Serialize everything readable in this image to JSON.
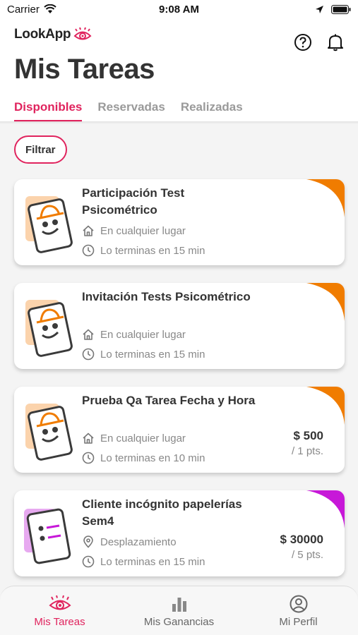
{
  "status_bar": {
    "carrier": "Carrier",
    "time": "9:08 AM"
  },
  "header": {
    "logo_text": "LookApp",
    "title": "Mis Tareas",
    "tabs": [
      {
        "label": "Disponibles",
        "active": true
      },
      {
        "label": "Reservadas",
        "active": false
      },
      {
        "label": "Realizadas",
        "active": false
      }
    ]
  },
  "filter_label": "Filtrar",
  "tasks": [
    {
      "title": "Participación Test Psicométrico",
      "location_icon": "home-icon",
      "location": "En cualquier lugar",
      "duration": "Lo terminas en 15 min",
      "price": "",
      "points": "",
      "icon": "incognito-card-icon",
      "accent": "#f07c00"
    },
    {
      "title": "Invitación Tests Psicométrico",
      "location_icon": "home-icon",
      "location": "En cualquier lugar",
      "duration": "Lo terminas en 15 min",
      "price": "",
      "points": "",
      "icon": "incognito-card-icon",
      "accent": "#f07c00"
    },
    {
      "title": "Prueba Qa Tarea Fecha y Hora",
      "location_icon": "home-icon",
      "location": "En cualquier lugar",
      "duration": "Lo terminas en 10 min",
      "price": "$ 500",
      "points": "/ 1 pts.",
      "icon": "incognito-card-icon",
      "accent": "#f07c00"
    },
    {
      "title": "Cliente incógnito papelerías Sem4",
      "location_icon": "location-pin-icon",
      "location": "Desplazamiento",
      "duration": "Lo terminas en 15 min",
      "price": "$ 30000",
      "points": "/ 5 pts.",
      "icon": "list-card-icon",
      "accent": "#c718d8"
    }
  ],
  "bottom_nav": [
    {
      "label": "Mis Tareas",
      "icon": "eye-icon",
      "active": true
    },
    {
      "label": "Mis Ganancias",
      "icon": "bar-chart-icon",
      "active": false
    },
    {
      "label": "Mi Perfil",
      "icon": "profile-icon",
      "active": false
    }
  ],
  "colors": {
    "accent": "#e0245e",
    "orange": "#f07c00",
    "purple": "#c718d8"
  }
}
